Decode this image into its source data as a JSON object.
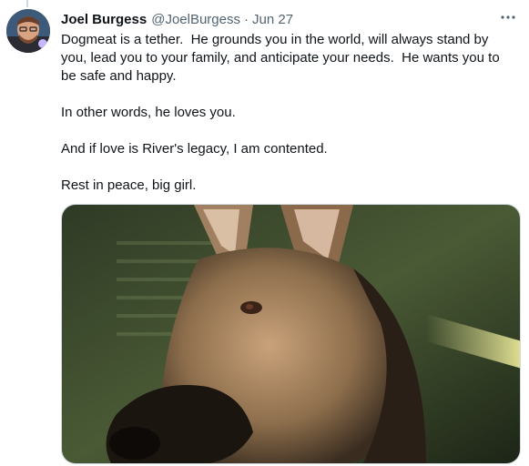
{
  "tweet": {
    "author_name": "Joel Burgess",
    "handle": "@JoelBurgess",
    "separator": "·",
    "date": "Jun 27",
    "paragraphs": [
      "Dogmeat is a tether.  He grounds you in the world, will always stand by you, lead you to your family, and anticipate your needs.  He wants you to be safe and happy.",
      "In other words, he loves you.",
      "And if love is River's legacy, I am contented.",
      "Rest in peace, big girl."
    ],
    "more_icon": "more-horizontal-icon",
    "media": {
      "subject": "german-shepherd-photo"
    }
  },
  "colors": {
    "text_primary": "#0f1419",
    "text_secondary": "#536471",
    "border": "#cfd9de"
  }
}
